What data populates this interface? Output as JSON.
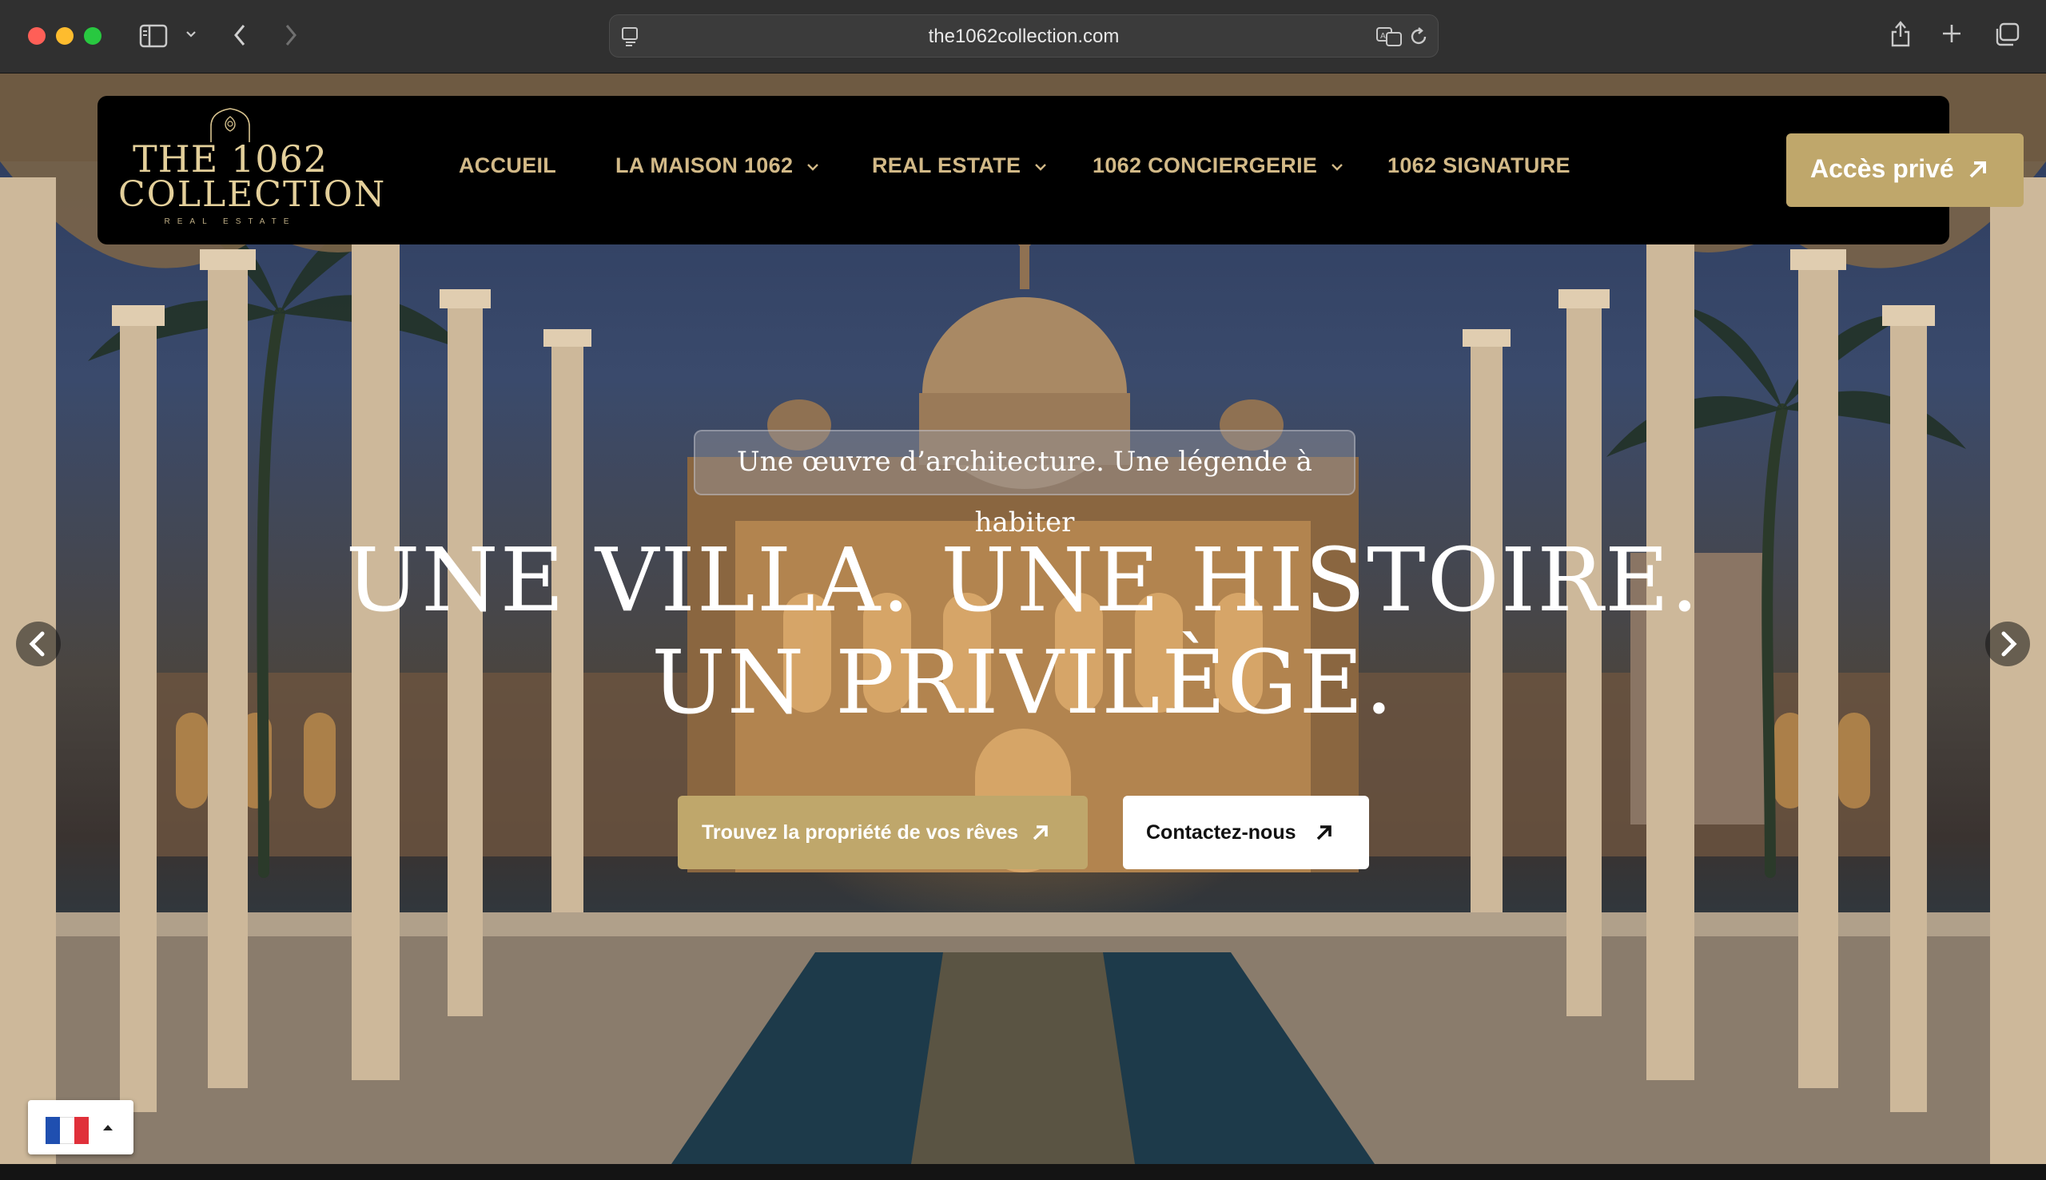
{
  "browser": {
    "url": "the1062collection.com"
  },
  "header": {
    "logo": {
      "line1": "THE 1062",
      "line2": "COLLECTION",
      "line3": "REAL ESTATE"
    },
    "nav": [
      {
        "label": "ACCUEIL",
        "has_dropdown": false
      },
      {
        "label": "LA MAISON 1062",
        "has_dropdown": true
      },
      {
        "label": "REAL ESTATE",
        "has_dropdown": true
      },
      {
        "label": "1062 CONCIERGERIE",
        "has_dropdown": true
      },
      {
        "label": "1062 SIGNATURE",
        "has_dropdown": false
      }
    ],
    "access_button": "Accès privé"
  },
  "hero": {
    "tagline": "Une œuvre d’architecture. Une légende à habiter",
    "headline": "UNE VILLA. UNE HISTOIRE. UN PRIVILÈGE.",
    "primary_button": "Trouvez la propriété de vos rêves",
    "secondary_button": "Contactez-nous"
  },
  "language": {
    "current": "fr"
  },
  "colors": {
    "accent_gold": "#bfa76b",
    "nav_text": "#d2b987",
    "header_bg": "#000000"
  }
}
